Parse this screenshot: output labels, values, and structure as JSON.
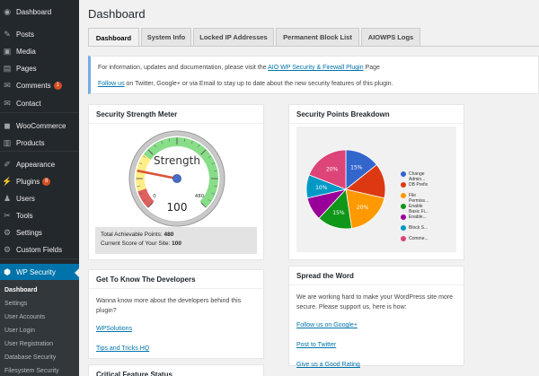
{
  "sidebar": {
    "items": [
      {
        "label": "Dashboard",
        "icon": "dashboard-icon",
        "glyph": "◉"
      },
      {
        "label": "Posts",
        "icon": "pin-icon",
        "glyph": "✎"
      },
      {
        "label": "Media",
        "icon": "media-icon",
        "glyph": "▣"
      },
      {
        "label": "Pages",
        "icon": "pages-icon",
        "glyph": "▤"
      },
      {
        "label": "Comments",
        "icon": "comment-icon",
        "glyph": "✉",
        "badge": "1"
      },
      {
        "label": "Contact",
        "icon": "mail-icon",
        "glyph": "✉"
      },
      {
        "label": "WooCommerce",
        "icon": "woocommerce-icon",
        "glyph": "◼"
      },
      {
        "label": "Products",
        "icon": "products-icon",
        "glyph": "▥"
      },
      {
        "label": "Appearance",
        "icon": "brush-icon",
        "glyph": "✐"
      },
      {
        "label": "Plugins",
        "icon": "plugin-icon",
        "glyph": "⚡",
        "badge": "8"
      },
      {
        "label": "Users",
        "icon": "users-icon",
        "glyph": "♟"
      },
      {
        "label": "Tools",
        "icon": "wrench-icon",
        "glyph": "✂"
      },
      {
        "label": "Settings",
        "icon": "settings-icon",
        "glyph": "⚙"
      },
      {
        "label": "Custom Fields",
        "icon": "gear-icon",
        "glyph": "⚙"
      },
      {
        "label": "WP Security",
        "icon": "shield-icon",
        "glyph": "⬢"
      }
    ],
    "submenu": [
      {
        "label": "Dashboard"
      },
      {
        "label": "Settings"
      },
      {
        "label": "User Accounts"
      },
      {
        "label": "User Login"
      },
      {
        "label": "User Registration"
      },
      {
        "label": "Database Security"
      },
      {
        "label": "Filesystem Security"
      }
    ]
  },
  "page": {
    "title": "Dashboard",
    "tabs": [
      {
        "label": "Dashboard"
      },
      {
        "label": "System Info"
      },
      {
        "label": "Locked IP Addresses"
      },
      {
        "label": "Permanent Block List"
      },
      {
        "label": "AIOWPS Logs"
      }
    ]
  },
  "info": {
    "line1_pre": "For information, updates and documentation, please visit the ",
    "line1_link": "AIO WP Security & Firewall Plugin",
    "line1_post": " Page",
    "line2_link": "Follow us",
    "line2_post": " on Twitter, Google+ or via Email to stay up to date about the new security features of this plugin."
  },
  "meter": {
    "title": "Security Strength Meter",
    "gauge_label": "Strength",
    "gauge_value": "100",
    "gauge_min": "0",
    "gauge_max": "480",
    "level": 0.2083,
    "total_label": "Total Achievable Points: ",
    "total_value": "480",
    "current_label": "Current Score of Your Site: ",
    "current_value": "100"
  },
  "points": {
    "title": "Security Points Breakdown",
    "chart_data": {
      "type": "pie",
      "title": "",
      "legend_position": "right",
      "categories": [
        "Change Admin...",
        "DB Prefix",
        "File Permiss...",
        "Enable Basic Fi...",
        "Enable...",
        "Block S...",
        "Comme..."
      ],
      "values": [
        15,
        15,
        20,
        15,
        10,
        10,
        20
      ],
      "labels": [
        "15%",
        "",
        "20%",
        "15%",
        "",
        "10%",
        "20%"
      ],
      "colors": [
        "#3366cc",
        "#dc3912",
        "#ff9900",
        "#109618",
        "#990099",
        "#0099c6",
        "#dd4477"
      ]
    }
  },
  "developers": {
    "title": "Get To Know The Developers",
    "text": "Wanna know more about the developers behind this plugin?",
    "link1": "WPSolutions",
    "link2": "Tips and Tricks HQ"
  },
  "spread": {
    "title": "Spread the Word",
    "text": "We are working hard to make your WordPress site more secure. Please support us, here is how:",
    "link1": "Follow us on Google+",
    "link2": "Post to Twitter",
    "link3": "Give us a Good Rating"
  },
  "critical": {
    "title": "Critical Feature Status"
  }
}
